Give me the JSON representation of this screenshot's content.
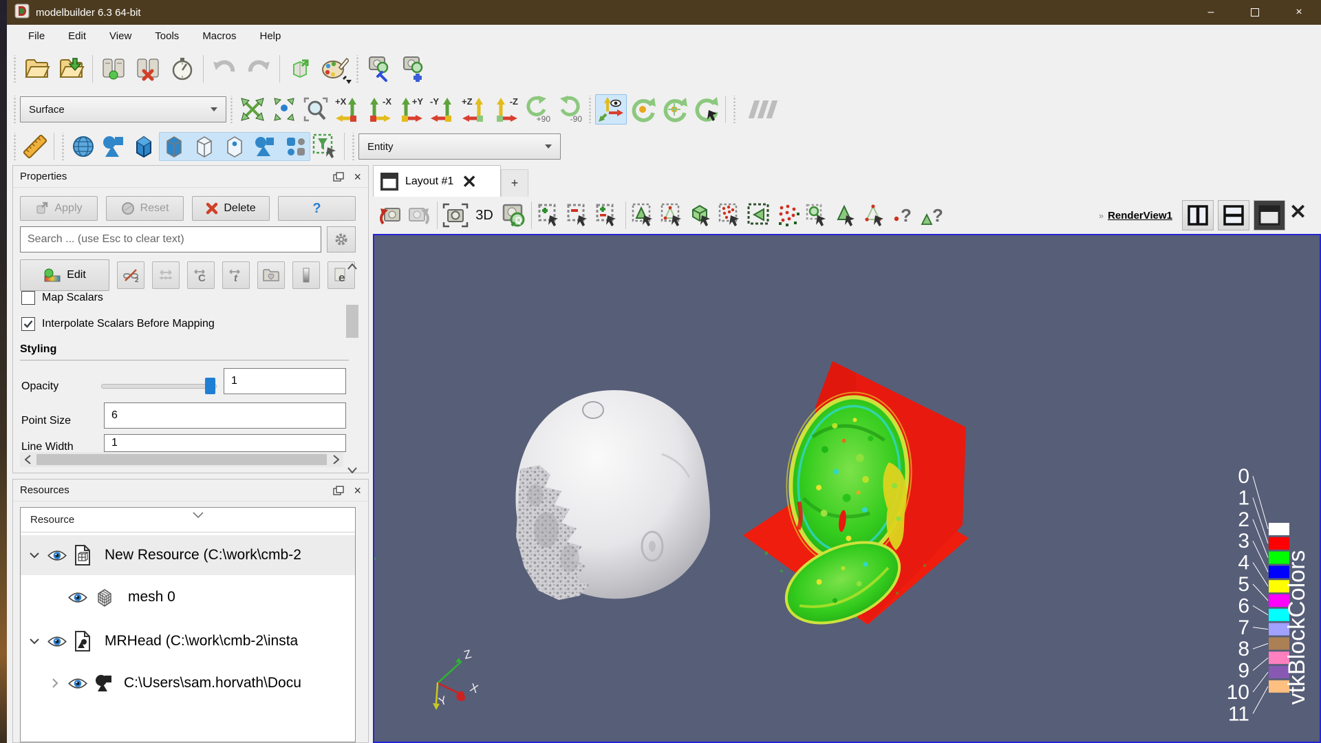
{
  "window": {
    "title": "modelbuilder 6.3 64-bit",
    "minimize_glyph": "–",
    "close_glyph": "×"
  },
  "menu": {
    "items": [
      "File",
      "Edit",
      "View",
      "Tools",
      "Macros",
      "Help"
    ]
  },
  "main_toolbar": {
    "icon_names": [
      "open-file-icon",
      "import-file-icon",
      "connect-server-icon",
      "disconnect-server-icon",
      "timer-icon",
      "undo-icon",
      "redo-icon",
      "export-scene-icon",
      "color-palette-icon",
      "zoom-to-data-edit-icon",
      "zoom-to-data-add-icon"
    ]
  },
  "camera_toolbar": {
    "representation_value": "Surface",
    "axis_labels": [
      "+X",
      "-X",
      "+Y",
      "-Y",
      "+Z",
      "-Z"
    ],
    "rotate_labels": [
      "+90",
      "-90"
    ]
  },
  "display_toolbar": {
    "entity_value": "Entity",
    "icon_names": [
      "ruler-icon",
      "mesh-sphere-icon",
      "glyph-icon",
      "solid-cube-icon",
      "surface-representation-icon",
      "wireframe-representation-icon",
      "points-representation-icon",
      "glyph-representation-icon",
      "blocks-representation-icon",
      "filter-selection-icon"
    ]
  },
  "properties": {
    "title": "Properties",
    "apply_label": "Apply",
    "reset_label": "Reset",
    "delete_label": "Delete",
    "help_label": "?",
    "search_placeholder": "Search ... (use Esc to clear text)",
    "edit_label": "Edit",
    "map_scalars_label": "Map Scalars",
    "interpolate_label": "Interpolate Scalars Before Mapping",
    "styling_label": "Styling",
    "opacity_label": "Opacity",
    "opacity_value": "1",
    "point_size_label": "Point Size",
    "point_size_value": "6",
    "line_width_label": "Line Width",
    "line_width_value": "1"
  },
  "resources": {
    "title": "Resources",
    "column_header": "Resource",
    "rows": [
      {
        "label": "New Resource (C:\\work\\cmb-2"
      },
      {
        "label": "mesh 0"
      },
      {
        "label": "MRHead (C:\\work\\cmb-2\\insta"
      },
      {
        "label": "C:\\Users\\sam.horvath\\Docu"
      }
    ]
  },
  "viewarea": {
    "tab_label": "Layout #1",
    "add_tab_label": "+",
    "threed_label": "3D",
    "view_name_prefix": "»",
    "view_name": "RenderView1"
  },
  "scene": {
    "background_color": "#575e78",
    "axes": {
      "x": "X",
      "y": "Y",
      "z": "Z"
    },
    "legend": {
      "title": "vtkBlockColors",
      "entries": [
        {
          "label": "0",
          "color": "#ffffff"
        },
        {
          "label": "1",
          "color": "#ff0000"
        },
        {
          "label": "2",
          "color": "#00ff00"
        },
        {
          "label": "3",
          "color": "#0000ff"
        },
        {
          "label": "4",
          "color": "#ffff00"
        },
        {
          "label": "5",
          "color": "#ff00ff"
        },
        {
          "label": "6",
          "color": "#00ffff"
        },
        {
          "label": "7",
          "color": "#a1a1ff"
        },
        {
          "label": "8",
          "color": "#ab8054"
        },
        {
          "label": "9",
          "color": "#ff80bf"
        },
        {
          "label": "10",
          "color": "#8759b3"
        },
        {
          "label": "11",
          "color": "#ffbf80"
        }
      ]
    }
  }
}
